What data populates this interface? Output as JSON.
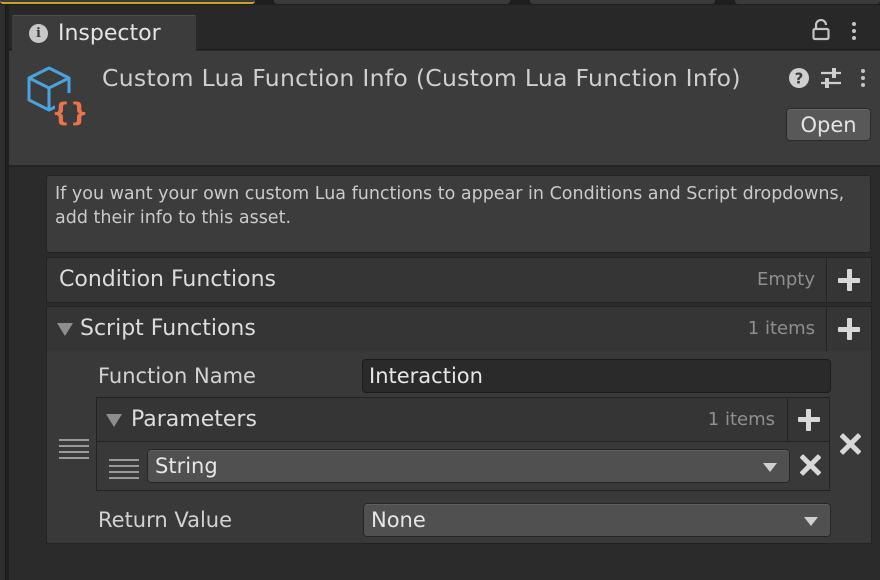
{
  "window": {
    "tab_title": "Inspector",
    "tab_icon": "info-icon"
  },
  "header": {
    "title": "Custom Lua Function Info (Custom Lua Function Info)",
    "asset_icon": "lua-script-asset-icon",
    "open_label": "Open",
    "icons": [
      "help-icon",
      "preset-sliders-icon",
      "kebab-menu-icon"
    ]
  },
  "help_box": {
    "text": "If you want your own custom Lua functions to appear in Conditions and Script dropdowns, add their info to this asset."
  },
  "condition_functions": {
    "label": "Condition Functions",
    "count": "Empty",
    "expanded": false
  },
  "script_functions": {
    "label": "Script Functions",
    "count": "1 items",
    "expanded": true,
    "items": [
      {
        "function_name_label": "Function Name",
        "function_name_value": "Interaction",
        "parameters": {
          "label": "Parameters",
          "count": "1 items",
          "items": [
            {
              "type": "String"
            }
          ]
        },
        "return_value_label": "Return Value",
        "return_value": "None"
      }
    ]
  },
  "colors": {
    "panel_bg": "#3c3c3c",
    "window_bg": "#2b2b2b",
    "accent_blue": "#4aa3df",
    "accent_orange": "#e9734a"
  }
}
